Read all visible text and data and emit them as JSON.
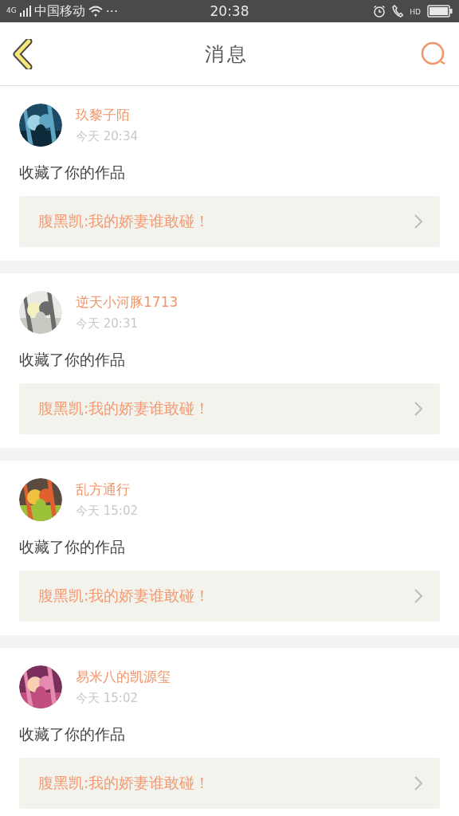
{
  "status_bar": {
    "network": "4G",
    "carrier": "中国移动",
    "more": "···",
    "time": "20:38",
    "hd": "HD"
  },
  "header": {
    "title": "消息"
  },
  "messages": [
    {
      "name": "玖黎子陌",
      "time": "今天 20:34",
      "action": "收藏了你的作品",
      "work": "腹黑凯:我的娇妻谁敢碰！"
    },
    {
      "name": "逆天小河豚1713",
      "time": "今天 20:31",
      "action": "收藏了你的作品",
      "work": "腹黑凯:我的娇妻谁敢碰！"
    },
    {
      "name": "乱方通行",
      "time": "今天 15:02",
      "action": "收藏了你的作品",
      "work": "腹黑凯:我的娇妻谁敢碰！"
    },
    {
      "name": "易米八的凯源玺",
      "time": "今天 15:02",
      "action": "收藏了你的作品",
      "work": "腹黑凯:我的娇妻谁敢碰！"
    }
  ]
}
